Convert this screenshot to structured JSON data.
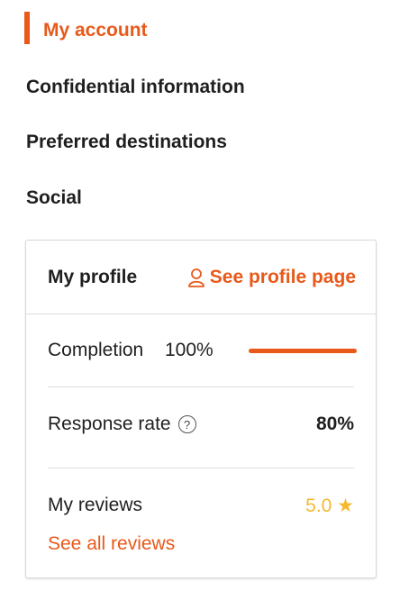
{
  "nav": {
    "my_account": "My account",
    "items": [
      "Confidential information",
      "Preferred destinations",
      "Social"
    ]
  },
  "profile": {
    "title": "My profile",
    "link_label": "See profile page",
    "link_icon": "user-icon",
    "completion_label": "Completion",
    "completion_value": "100%",
    "completion_progress": 1.0,
    "response_label": "Response rate",
    "response_help_icon": "question-circle-icon",
    "response_value": "80%",
    "reviews_label": "My reviews",
    "reviews_value": "5.0 ★",
    "see_all_reviews": "See all reviews"
  },
  "colors": {
    "accent": "#e8591a",
    "star": "#f5b82e",
    "text": "#1f1f1f",
    "divider": "#dedede"
  }
}
